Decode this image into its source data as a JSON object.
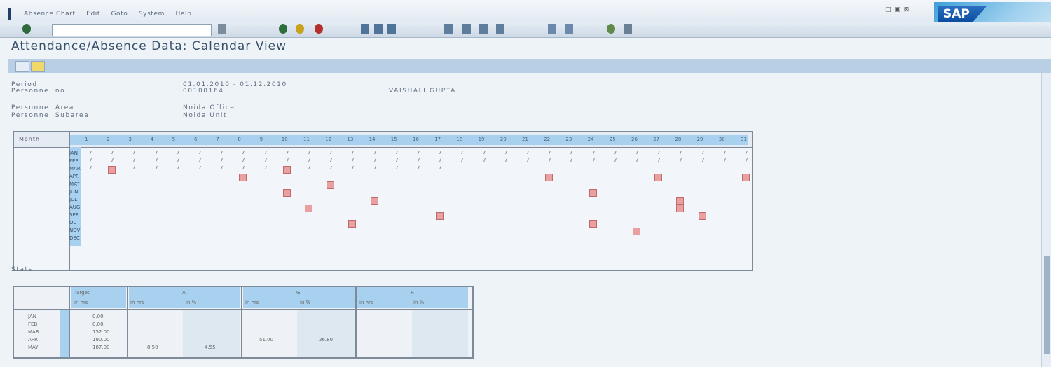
{
  "menubar": {
    "items": [
      "Absence Chart",
      "Edit",
      "Goto",
      "System",
      "Help"
    ],
    "brand": "SAP",
    "window_controls": "□ ▣ ⊠"
  },
  "toolbar": {
    "command_field": ""
  },
  "page": {
    "title": "Attendance/Absence Data: Calendar View"
  },
  "header": {
    "period_label": "Period",
    "period_value": "01.01.2010 - 01.12.2010",
    "personnel_no_label": "Personnel no.",
    "personnel_no_value": "00100164",
    "employee_name": "VAISHALI GUPTA",
    "personnel_area_label": "Personnel Area",
    "personnel_area_value": "Noida Office",
    "personnel_subarea_label": "Personnel Subarea",
    "personnel_subarea_value": "Noida Unit"
  },
  "calendar": {
    "corner_label": "Month",
    "days": [
      "1",
      "2",
      "3",
      "4",
      "5",
      "6",
      "7",
      "8",
      "9",
      "10",
      "11",
      "12",
      "13",
      "14",
      "15",
      "16",
      "17",
      "18",
      "19",
      "20",
      "21",
      "22",
      "23",
      "24",
      "25",
      "26",
      "27",
      "28",
      "29",
      "30",
      "31"
    ],
    "months": [
      "JAN",
      "FEB",
      "MAR",
      "APR",
      "MAY",
      "JUN",
      "JUL",
      "AUG",
      "SEP",
      "OCT",
      "NOV",
      "DEC"
    ]
  },
  "stats": {
    "title": "Stats",
    "target_label": "Target",
    "groups": [
      "A",
      "G",
      "R"
    ],
    "sub_headers": [
      "in hrs",
      "in hrs",
      "in %",
      "in hrs",
      "in %",
      "in hrs",
      "in %"
    ],
    "rows": [
      {
        "month": "JAN",
        "target": "0.00",
        "a_hrs": "",
        "a_pct": "",
        "g_hrs": "",
        "g_pct": ""
      },
      {
        "month": "FEB",
        "target": "0.00",
        "a_hrs": "",
        "a_pct": "",
        "g_hrs": "",
        "g_pct": ""
      },
      {
        "month": "MAR",
        "target": "152.00",
        "a_hrs": "",
        "a_pct": "",
        "g_hrs": "",
        "g_pct": ""
      },
      {
        "month": "APR",
        "target": "190.00",
        "a_hrs": "",
        "a_pct": "",
        "g_hrs": "51.00",
        "g_pct": "26.80"
      },
      {
        "month": "MAY",
        "target": "187.00",
        "a_hrs": "8.50",
        "a_pct": "4.55",
        "g_hrs": "",
        "g_pct": ""
      }
    ]
  },
  "colors": {
    "accent": "#a8d1ef",
    "marker": "#e8a0a0"
  }
}
